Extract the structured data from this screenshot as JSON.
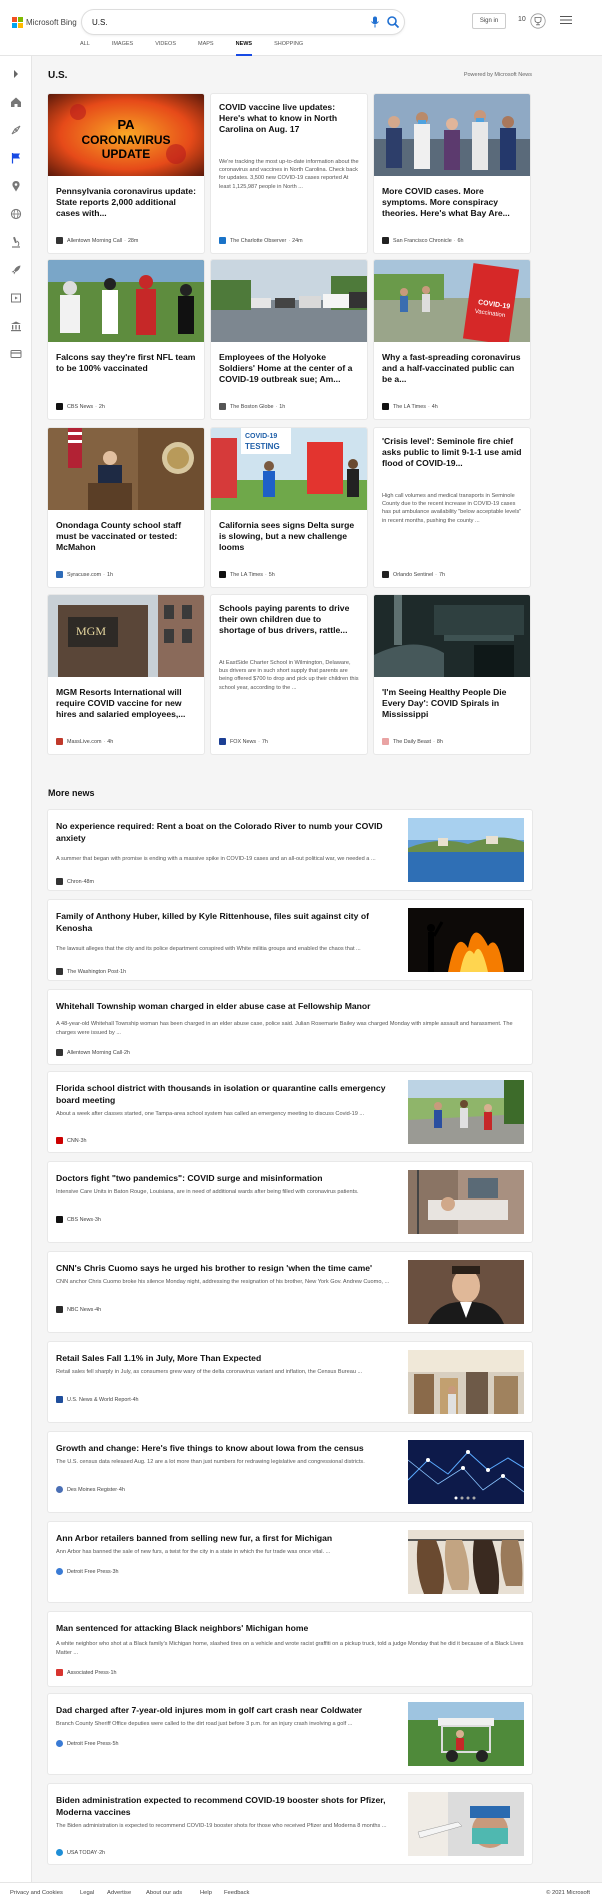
{
  "header": {
    "logo_text": "Microsoft Bing",
    "search_value": "U.S.",
    "signin_label": "Sign in",
    "rewards_count": "10",
    "nav": [
      "ALL",
      "IMAGES",
      "VIDEOS",
      "MAPS",
      "NEWS",
      "SHOPPING"
    ],
    "active_nav": "NEWS"
  },
  "sidebar_icons": [
    "expand-icon",
    "home-icon",
    "compass-icon",
    "flag-icon",
    "pin-icon",
    "globe-icon",
    "microscope-icon",
    "rocket-icon",
    "film-icon",
    "bank-icon",
    "card-icon"
  ],
  "page": {
    "title": "U.S.",
    "powered": "Powered by Microsoft News",
    "more_news": "More news"
  },
  "cards": [
    {
      "title": "Pennsylvania coronavirus update: State reports 2,000 additional cases with...",
      "source": "Allentown Morning Call",
      "time": "28m",
      "thumb": "covid-graphic",
      "image_text": "PA CORONAVIRUS UPDATE",
      "logo_color": "#333333"
    },
    {
      "title": "COVID vaccine live updates: Here's what to know in North Carolina on Aug. 17",
      "snippet": "We're tracking the most up-to-date information about the coronavirus and vaccines in North Carolina. Check back for updates. 3,500 new COVID-19 cases reported At least 1,125,987 people in North ...",
      "source": "The Charlotte Observer",
      "time": "24m",
      "logo_color": "#1a73c8"
    },
    {
      "title": "More COVID cases. More symptoms. More conspiracy theories. Here's what Bay Are...",
      "source": "San Francisco Chronicle",
      "time": "6h",
      "thumb": "protest",
      "logo_color": "#222222"
    },
    {
      "title": "Falcons say they're first NFL team to be 100% vaccinated",
      "source": "CBS News",
      "time": "2h",
      "thumb": "football",
      "logo_color": "#111111"
    },
    {
      "title": "Employees of the Holyoke Soldiers' Home at the center of a COVID-19 outbreak sue; Am...",
      "source": "The Boston Globe",
      "time": "1h",
      "thumb": "street",
      "logo_color": "#555555"
    },
    {
      "title": "Why a fast-spreading coronavirus and a half-vaccinated public can be a...",
      "source": "The LA Times",
      "time": "4h",
      "thumb": "vaccination-sign",
      "image_text": "COVID-19 Vaccination",
      "logo_color": "#111111"
    },
    {
      "title": "Onondaga County school staff must be vaccinated or tested: McMahon",
      "source": "Syracuse.com",
      "time": "1h",
      "thumb": "podium",
      "logo_color": "#2e6bb8"
    },
    {
      "title": "California sees signs Delta surge is slowing, but a new challenge looms",
      "source": "The LA Times",
      "time": "5h",
      "thumb": "testing-site",
      "image_text": "COVID-19 TESTING",
      "logo_color": "#111111"
    },
    {
      "title": "'Crisis level': Seminole fire chief asks public to limit 9-1-1 use amid flood of COVID-19...",
      "snippet": "High call volumes and medical transports in Seminole County due to the recent increase in COVID-19 cases has put ambulance availability \"below acceptable levels\" in recent months, pushing the county ...",
      "source": "Orlando Sentinel",
      "time": "7h",
      "logo_color": "#222222"
    },
    {
      "title": "MGM Resorts International will require COVID vaccine for new hires and salaried employees,...",
      "source": "MassLive.com",
      "time": "4h",
      "thumb": "mgm-building",
      "logo_color": "#c0392b"
    },
    {
      "title": "Schools paying parents to drive their own children due to shortage of bus drivers, rattle...",
      "snippet": "At EastSide Charter School in Wilmington, Delaware, bus drivers are in such short supply that parents are being offered $700 to drop and pick up their children this school year, according to the ...",
      "source": "FOX News",
      "time": "7h",
      "logo_color": "#1c3f94"
    },
    {
      "title": "'I'm Seeing Healthy People Die Every Day': COVID Spirals in Mississippi",
      "source": "The Daily Beast",
      "time": "8h",
      "thumb": "hospital-dark",
      "logo_color": "#e9a3a3"
    }
  ],
  "more": [
    {
      "title": "No experience required: Rent a boat on the Colorado River to numb your COVID anxiety",
      "snippet": "A summer that began with promise is ending with a massive spike in COVID-19 cases and an all-out political war, we needed a ...",
      "source": "Chron",
      "time": "48m",
      "thumb": "lake",
      "logo_color": "#333333"
    },
    {
      "title": "Family of Anthony Huber, killed by Kyle Rittenhouse, files suit against city of Kenosha",
      "snippet": "The lawsuit alleges that the city and its police department conspired with White militia groups and enabled the chaos that ...",
      "source": "The Washington Post",
      "time": "1h",
      "thumb": "fire",
      "logo_color": "#333333"
    },
    {
      "title": "Whitehall Township woman charged in elder abuse case at Fellowship Manor",
      "snippet": "A 48-year-old Whitehall Township woman has been charged in an elder abuse case, police said. Julian Rosemarie Bailey was charged Monday with simple assault and harassment. The charges were issued by ...",
      "source": "Allentown Morning Call",
      "time": "2h",
      "logo_color": "#333333"
    },
    {
      "title": "Florida school district with thousands in isolation or quarantine calls emergency board meeting",
      "snippet": "About a week after classes started, one Tampa-area school system has called an emergency meeting to discuss Covid-19 ...",
      "source": "CNN",
      "time": "3h",
      "thumb": "school-line",
      "logo_color": "#cc0000"
    },
    {
      "title": "Doctors fight \"two pandemics\": COVID surge and misinformation",
      "snippet": "Intensive Care Units in Baton Rouge, Louisiana, are in need of additional wards after being filled with coronavirus patients.",
      "source": "CBS News",
      "time": "3h",
      "thumb": "icu",
      "logo_color": "#111111"
    },
    {
      "title": "CNN's Chris Cuomo says he urged his brother to resign 'when the time came'",
      "snippet": "CNN anchor Chris Cuomo broke his silence Monday night, addressing the resignation of his brother, New York Gov. Andrew Cuomo, ...",
      "source": "NBC News",
      "time": "4h",
      "thumb": "portrait",
      "logo_color": "#2a2a2a"
    },
    {
      "title": "Retail Sales Fall 1.1% in July, More Than Expected",
      "snippet": "Retail sales fell sharply in July, as consumers grew wary of the delta coronavirus variant and inflation, the Census Bureau ...",
      "source": "U.S. News & World Report",
      "time": "4h",
      "thumb": "mall",
      "logo_color": "#1f4e9c"
    },
    {
      "title": "Growth and change: Here's five things to know about Iowa from the census",
      "snippet": "The U.S. census data released Aug. 12 are a lot more than just numbers for redrawing legislative and congressional districts.",
      "source": "Des Moines Register",
      "time": "4h",
      "thumb": "network",
      "logo_color": "#4a6fb5"
    },
    {
      "title": "Ann Arbor retailers banned from selling new fur, a first for Michigan",
      "snippet": "Ann Arbor has banned the sale of new furs, a twist for the city in a state in which the fur trade was once vital. ...",
      "source": "Detroit Free Press",
      "time": "3h",
      "thumb": "fur",
      "logo_color": "#3a7bd5"
    },
    {
      "title": "Man sentenced for attacking Black neighbors' Michigan home",
      "snippet": "A white neighbor who shot at a Black family's Michigan home, slashed tires on a vehicle and wrote racist graffiti on a pickup truck, told a judge Monday that he did it because of a Black Lives Matter ...",
      "source": "Associated Press",
      "time": "1h",
      "logo_color": "#d8342f"
    },
    {
      "title": "Dad charged after 7-year-old injures mom in golf cart crash near Coldwater",
      "snippet": "Branch County Sheriff Office deputies were called to the dirt road just before 3 p.m. for an injury crash involving a golf ...",
      "source": "Detroit Free Press",
      "time": "5h",
      "thumb": "golfcart",
      "logo_color": "#3a7bd5"
    },
    {
      "title": "Biden administration expected to recommend COVID-19 booster shots for Pfizer, Moderna vaccines",
      "snippet": "The Biden administration is expected to recommend COVID-19 booster shots for those who received Pfizer and Moderna 8 months ...",
      "source": "USA TODAY",
      "time": "2h",
      "thumb": "nurse",
      "logo_color": "#1f8ed6"
    }
  ],
  "footer": {
    "links": [
      "Privacy and Cookies",
      "Legal",
      "Advertise",
      "About our ads",
      "Help",
      "Feedback"
    ],
    "copyright": "© 2021 Microsoft"
  }
}
